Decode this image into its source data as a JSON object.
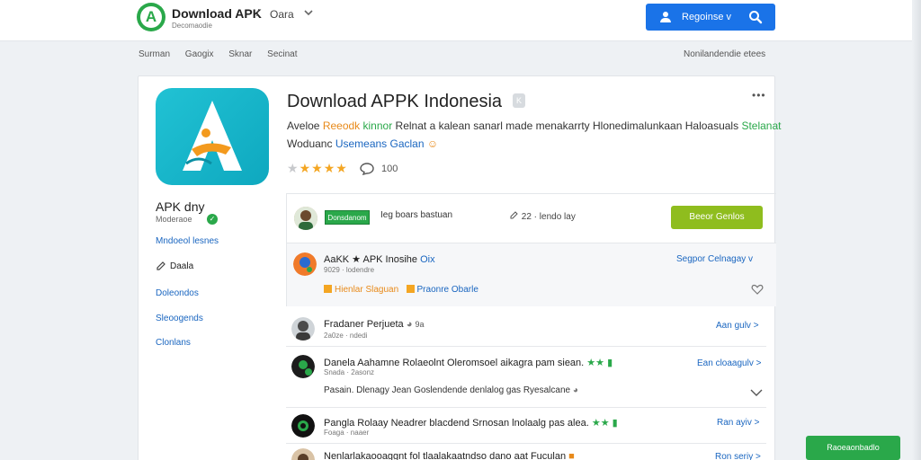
{
  "header": {
    "brand_title": "Download APK",
    "brand_separator": "/",
    "brand_language": "Oara",
    "brand_subtitle": "Decomaodie",
    "account_button_label": "Regoinse v"
  },
  "nav": {
    "items": [
      "Surman",
      "Gaogix",
      "Sknar",
      "Secinat"
    ],
    "right_label": "Nonilandendie etees"
  },
  "app": {
    "title": "Download APPK Indonesia",
    "name": "APK dny",
    "developer": "Moderaoe",
    "verified_mark": "✓",
    "description_line1": [
      {
        "text": "Aveloe ",
        "color": "default"
      },
      {
        "text": "Reeodk ",
        "color": "orange"
      },
      {
        "text": "kinnor ",
        "color": "green"
      },
      {
        "text": "Relnat a kalean sanarl made menakarrty  Hlonedimalunkaan Haloasuals ",
        "color": "default"
      },
      {
        "text": "Stelanat",
        "color": "green"
      }
    ],
    "description_line2": [
      {
        "text": "Woduanc ",
        "color": "default"
      },
      {
        "text": "Usemeans Gaclan ",
        "color": "blue"
      }
    ],
    "rating_stars": 5,
    "comment_count": "100"
  },
  "sidebar": {
    "links": [
      "Mndoeol lesnes",
      "Daala",
      "Doleondos",
      "Sleoogends",
      "Clonlans"
    ]
  },
  "featured": {
    "tag": "Donsdanom",
    "text": "Ieg boars bastuan",
    "meta": "22 · lendo lay",
    "button": "Beeor Genlos"
  },
  "reviews": [
    {
      "name": "AaKK ★ APK Inosihe",
      "name_suffix": "Oix",
      "sub": "9029 · lodendre",
      "link": "Segpor Celnagay v",
      "tag1": "Hienlar Slaguan",
      "tag2": "Praonre Obarle"
    },
    {
      "name": "Fradaner Perjueta",
      "name_suffix": "9a",
      "sub": "2a0ze · ndedi",
      "link": "Aan gulv >"
    },
    {
      "name": "Danela Aahamne Rolaeolnt  Oleromsoel aikagra pam siean.",
      "sub": "Snada · 2asonz",
      "body": "Pasain.   Dlenagy  Jean  Goslendende denlalog  gas Ryesalcane",
      "link": "Ean cloaagulv >"
    },
    {
      "name": "Pangla Rolaay  Neadrer blacdend  Srnosan  lnolaalg pas  alea.",
      "sub": "Foaga · naaer",
      "link": "Ran ayiv >"
    },
    {
      "name": "Nenlarlakaooaggnt  fol tlaalakaatndso  dano  aat  Fuculan",
      "link": "Ron seriy >"
    }
  ],
  "fab_label": "Raoeaonbadlo",
  "colors": {
    "accent_blue": "#1a73e8",
    "brand_green": "#2aa84a",
    "cta_green": "#8fbd1e",
    "link_blue": "#1a66c0",
    "star_orange": "#f4a623"
  },
  "icons": [
    "logo-icon",
    "user-icon",
    "search-icon",
    "chevron-down-icon",
    "edit-icon",
    "comment-icon",
    "more-icon",
    "heart-icon",
    "star-icon"
  ]
}
